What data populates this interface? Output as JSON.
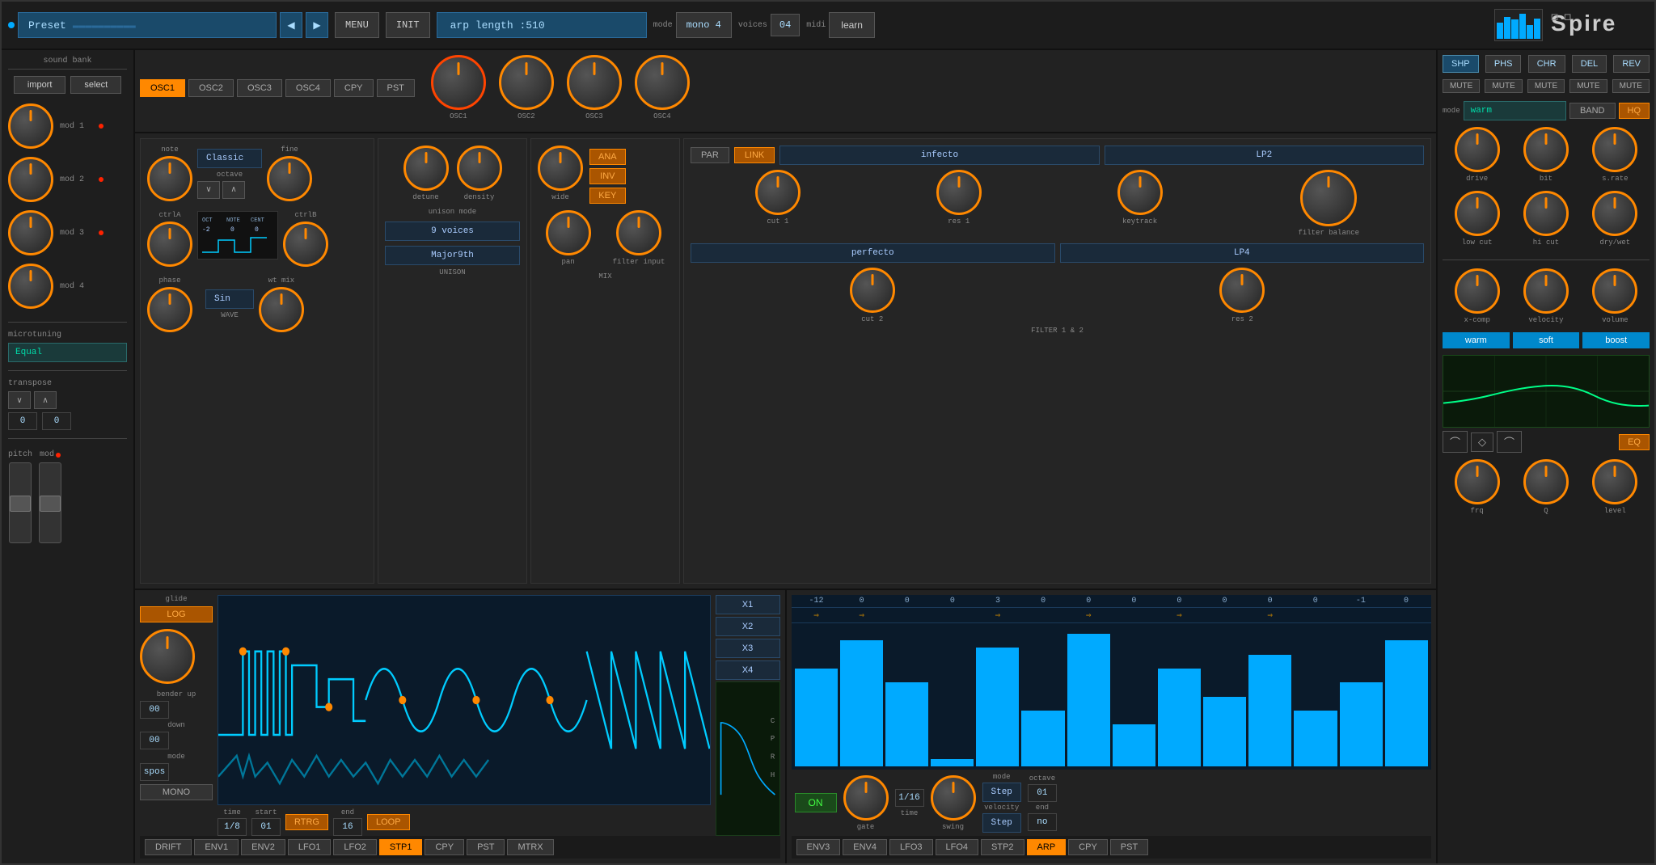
{
  "header": {
    "preset_label": "Preset",
    "menu_btn": "MENU",
    "init_btn": "INIT",
    "arp_display": "arp length :510",
    "mode_label": "mode",
    "mode_value": "mono 4",
    "voices_label": "voices",
    "voices_value": "04",
    "midi_label": "midi",
    "learn_btn": "learn",
    "logo": "Spire"
  },
  "sound_bank": {
    "label": "sound bank",
    "import_btn": "import",
    "select_btn": "select"
  },
  "mod_slots": [
    {
      "label": "mod 1"
    },
    {
      "label": "mod 2"
    },
    {
      "label": "mod 3"
    },
    {
      "label": "mod 4"
    }
  ],
  "microtuning": {
    "label": "microtuning",
    "value": "Equal"
  },
  "transpose": {
    "label": "transpose",
    "down_value": "0",
    "up_value": "0"
  },
  "pitch_label": "pitch",
  "mod_label": "mod",
  "osc_tabs": [
    "OSC1",
    "OSC2",
    "OSC3",
    "OSC4"
  ],
  "copy_btn": "CPY",
  "pst_btn": "PST",
  "osc_panel": {
    "note_label": "note",
    "waveform": "Classic",
    "octave_label": "octave",
    "fine_label": "fine",
    "ctrla_label": "ctrlA",
    "ctrlb_label": "ctrlB",
    "oct_val": "-2",
    "note_val": "0",
    "cent_val": "0",
    "wave_label": "WAVE",
    "phase_label": "phase",
    "wt_mix_label": "wt mix",
    "wave_value": "Sin"
  },
  "osc_knobs": [
    "OSC1",
    "OSC2",
    "OSC3",
    "OSC4"
  ],
  "unison": {
    "title": "UNISON",
    "detune_label": "detune",
    "density_label": "density",
    "mode_label": "unison mode",
    "mode_value": "9 voices",
    "chord_value": "Major9th"
  },
  "mix": {
    "title": "MIX",
    "wide_label": "wide",
    "pan_label": "pan",
    "filter_input_label": "filter input",
    "ana_btn": "ANA",
    "inv_btn": "INV",
    "key_btn": "KEY"
  },
  "filter": {
    "title": "FILTER 1 & 2",
    "filter1": "infecto",
    "filter1_type": "LP2",
    "filter2": "perfecto",
    "filter2_type": "LP4",
    "cut1_label": "cut 1",
    "res1_label": "res 1",
    "keytrack_label": "keytrack",
    "cut2_label": "cut 2",
    "res2_label": "res 2",
    "filter_balance_label": "filter balance",
    "par_btn": "PAR",
    "link_btn": "LINK"
  },
  "fx": {
    "buttons": [
      "SHP",
      "PHS",
      "CHR",
      "DEL",
      "REV"
    ],
    "mute_btns": [
      "MUTE",
      "MUTE",
      "MUTE",
      "MUTE",
      "MUTE"
    ],
    "mode_label": "mode",
    "mode_value": "warm",
    "band_btn": "BAND",
    "hq_btn": "HQ",
    "drive_label": "drive",
    "bit_label": "bit",
    "srate_label": "s.rate",
    "lowcut_label": "low cut",
    "hicut_label": "hi cut",
    "drywet_label": "dry/wet",
    "xcomp_label": "x-comp",
    "velocity_label": "velocity",
    "volume_label": "volume",
    "warm_btn": "warm",
    "soft_btn": "soft",
    "boost_btn": "boost",
    "frq_label": "frq",
    "q_label": "Q",
    "level_label": "level",
    "eq_btn": "EQ"
  },
  "env_lfo": {
    "glide_label": "glide",
    "log_btn": "LOG",
    "mono_btn": "MONO",
    "bender_up_label": "bender up",
    "bender_down_label": "down",
    "bender_up_val": "00",
    "bender_down_val": "00",
    "time_label": "time",
    "time_val": "1/8",
    "start_label": "start",
    "start_val": "01",
    "rtrg_btn": "RTRG",
    "mode_label": "mode",
    "mode_val": "spos",
    "end_label": "end",
    "end_val": "16",
    "loop_btn": "LOOP",
    "x_labels": [
      "X1",
      "X2",
      "X3",
      "X4"
    ],
    "c_label": "C",
    "p_label": "P",
    "r_label": "R",
    "h_label": "H",
    "tabs": [
      "DRIFT",
      "ENV1",
      "ENV2",
      "LFO1",
      "LFO2",
      "STP1",
      "CPY",
      "PST",
      "MTRX"
    ]
  },
  "arp": {
    "on_btn": "ON",
    "gate_label": "gate",
    "time_label": "time",
    "time_val": "1/16",
    "swing_label": "swing",
    "mode_label": "mode",
    "mode_val": "Step",
    "octave_label": "octave",
    "octave_val": "01",
    "velocity_label": "velocity",
    "velocity_val": "Step",
    "end_label": "end",
    "end_val": "no",
    "numbers": [
      "-12",
      "0",
      "0",
      "0",
      "3",
      "0",
      "0",
      "0",
      "0",
      "0",
      "0",
      "0",
      "-1",
      "0"
    ],
    "bars_heights": [
      70,
      90,
      60,
      0,
      85,
      40,
      95,
      30,
      70,
      50,
      80,
      40,
      60,
      90
    ],
    "tabs": [
      "ENV3",
      "ENV4",
      "LFO3",
      "LFO4",
      "STP2",
      "ARP",
      "CPY",
      "PST"
    ]
  },
  "shape_btns": [
    "⌒",
    "◇",
    "⌒"
  ],
  "tabs_bottom_right": {
    "eq_btn": "EQ"
  }
}
